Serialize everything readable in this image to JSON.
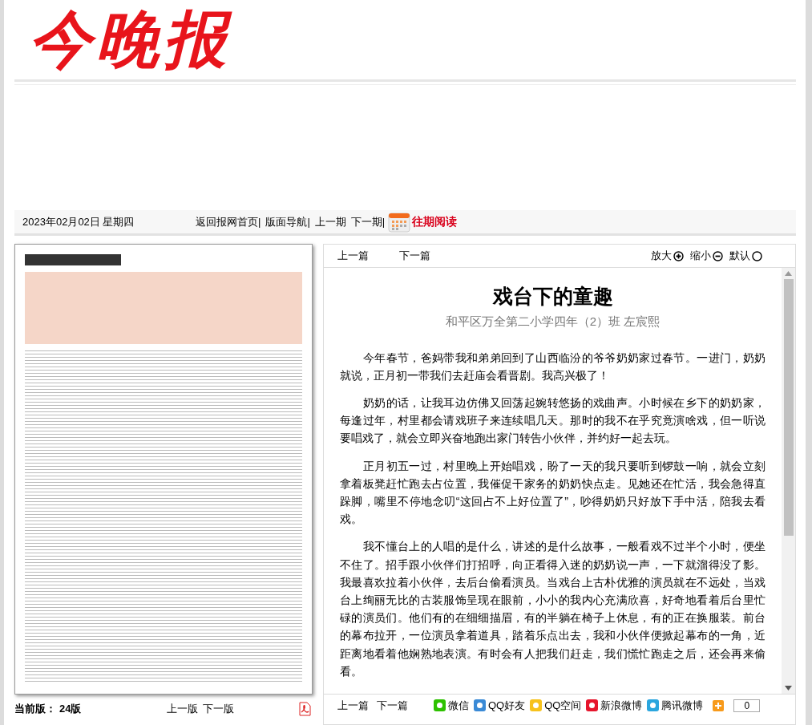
{
  "logo": "今晚报",
  "date": "2023年02月02日 星期四",
  "nav_links": [
    "返回报网首页|",
    "版面导航|",
    "上一期",
    "下一期|"
  ],
  "archive_link": "往期阅读",
  "edition": {
    "label": "当前版：",
    "value": "24版"
  },
  "edition_nav": [
    "上一版",
    "下一版"
  ],
  "article_nav": [
    "上一篇",
    "下一篇"
  ],
  "zoom_controls": [
    {
      "label": "放大",
      "kind": "plus"
    },
    {
      "label": "缩小",
      "kind": "minus"
    },
    {
      "label": "默认",
      "kind": "reset"
    }
  ],
  "article": {
    "title": "戏台下的童趣",
    "byline": "和平区万全第二小学四年（2）班 左宸熙",
    "paragraphs": [
      "今年春节，爸妈带我和弟弟回到了山西临汾的爷爷奶奶家过春节。一进门，奶奶就说，正月初一带我们去赶庙会看晋剧。我高兴极了！",
      "奶奶的话，让我耳边仿佛又回荡起婉转悠扬的戏曲声。小时候在乡下的奶奶家，每逢过年，村里都会请戏班子来连续唱几天。那时的我不在乎究竟演啥戏，但一听说要唱戏了，就会立即兴奋地跑出家门转告小伙伴，并约好一起去玩。",
      "正月初五一过，村里晚上开始唱戏，盼了一天的我只要听到锣鼓一响，就会立刻拿着板凳赶忙跑去占位置，我催促干家务的奶奶快点走。见她还在忙活，我会急得直跺脚，嘴里不停地念叨“这回占不上好位置了”，吵得奶奶只好放下手中活，陪我去看戏。",
      "我不懂台上的人唱的是什么，讲述的是什么故事，一般看戏不过半个小时，便坐不住了。招手跟小伙伴们打招呼，向正看得入迷的奶奶说一声，一下就溜得没了影。我最喜欢拉着小伙伴，去后台偷看演员。当戏台上古朴优雅的演员就在不远处，当戏台上绚丽无比的古装服饰呈现在眼前，小小的我内心充满欣喜，好奇地看着后台里忙碌的演员们。他们有的在细细描眉，有的半躺在椅子上休息，有的正在换服装。前台的幕布拉开，一位演员拿着道具，踏着乐点出去，我和小伙伴便掀起幕布的一角，近距离地看着他娴熟地表演。有时会有人把我们赶走，我们慌忙跑走之后，还会再来偷看。"
    ]
  },
  "footer_nav": [
    "上一篇",
    "下一篇"
  ],
  "share": [
    {
      "label": "微信",
      "kind": "wechat"
    },
    {
      "label": "QQ好友",
      "kind": "qq"
    },
    {
      "label": "QQ空间",
      "kind": "qzone"
    },
    {
      "label": "新浪微博",
      "kind": "sina"
    },
    {
      "label": "腾讯微博",
      "kind": "tencent"
    }
  ],
  "share_count": "0"
}
